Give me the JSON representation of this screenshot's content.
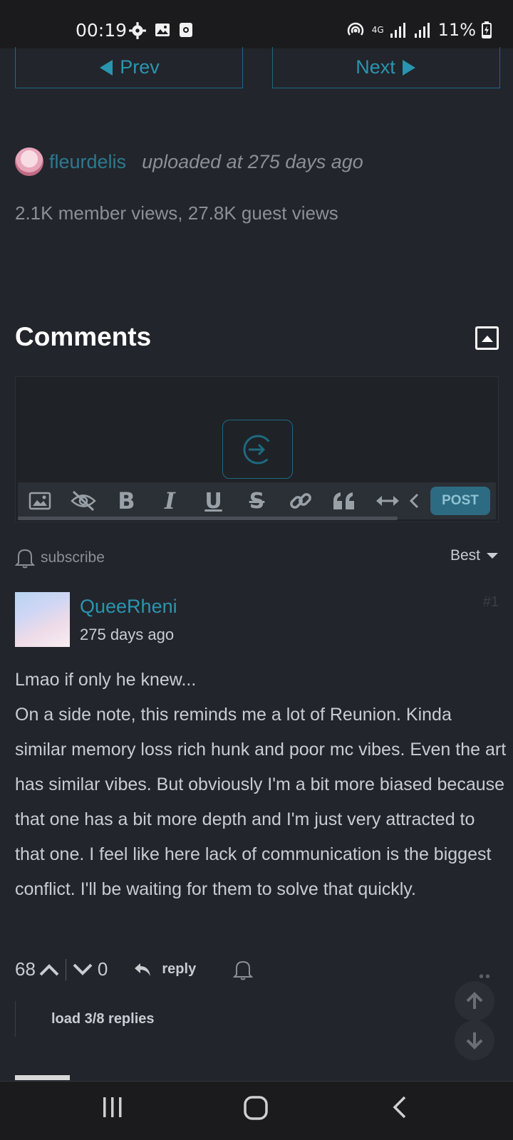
{
  "status_bar": {
    "time": "00:19",
    "network": "4G",
    "battery": "11%",
    "icons": [
      "settings-gear-icon",
      "image-icon",
      "screen-record-icon",
      "hotspot-icon",
      "signal-icon",
      "battery-charging-icon"
    ]
  },
  "pager": {
    "prev_label": "Prev",
    "next_label": "Next"
  },
  "uploader": {
    "name": "fleurdelis",
    "uploaded": "uploaded at 275 days ago"
  },
  "views": "2.1K member views, 27.8K guest views",
  "comments": {
    "title": "Comments",
    "editor": {
      "post_label": "POST"
    },
    "subscribe_label": "subscribe",
    "sort_label": "Best"
  },
  "comment": {
    "username": "QueeRheni",
    "time": "275 days ago",
    "number": "#1",
    "lines": [
      "Lmao if only he knew...",
      "On a side note, this reminds me a lot of Reunion. Kinda similar memory loss rich hunk and poor mc vibes. Even the art has similar vibes. But obviously I'm a bit more biased because that one has a bit more depth and I'm just very attracted to that one. I feel like here lack of communication is the biggest conflict. I'll be waiting for them to solve that quickly."
    ],
    "upvotes": "68",
    "downvotes": "0",
    "reply_label": "reply",
    "load_replies": "load 3/8 replies"
  },
  "colors": {
    "accent": "#2a95b0",
    "background": "#22252b",
    "text": "#c9ccd1"
  }
}
